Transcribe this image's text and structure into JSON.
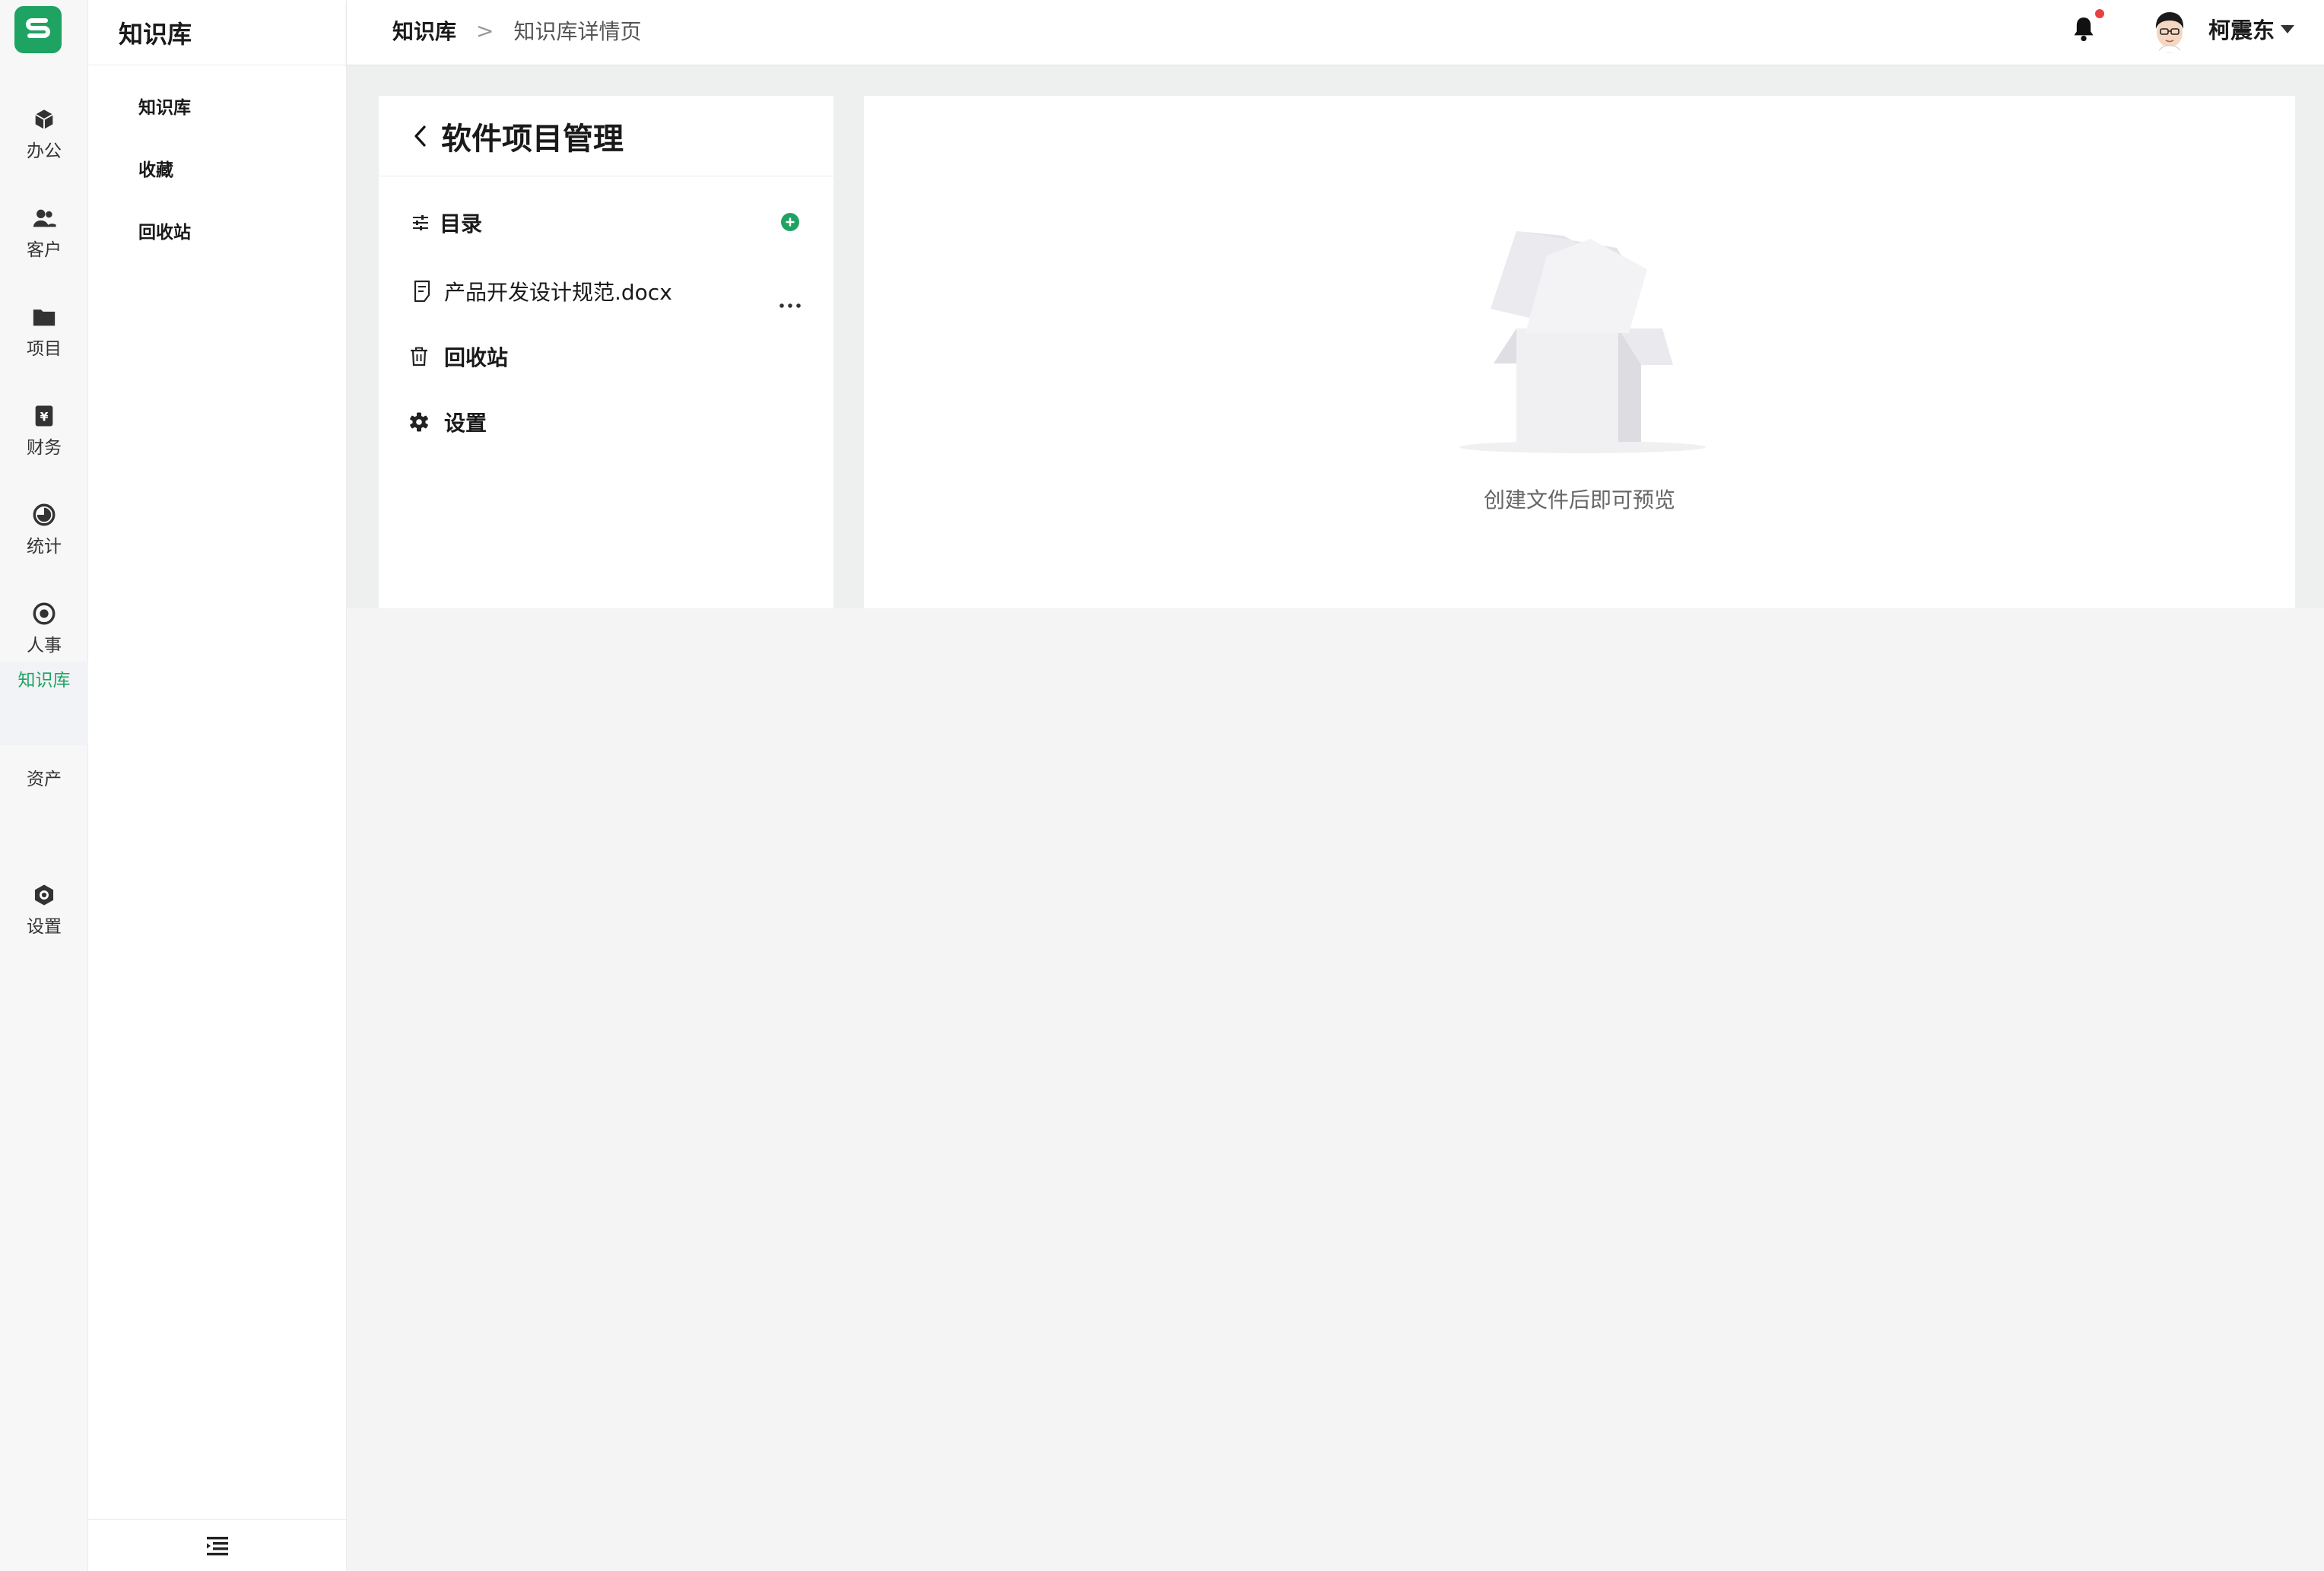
{
  "rail": {
    "logo": "S",
    "items": [
      {
        "label": "办公",
        "icon": "cube-icon"
      },
      {
        "label": "客户",
        "icon": "users-icon"
      },
      {
        "label": "项目",
        "icon": "folder-icon"
      },
      {
        "label": "财务",
        "icon": "yen-icon"
      },
      {
        "label": "统计",
        "icon": "pie-chart-icon"
      },
      {
        "label": "人事",
        "icon": "target-icon"
      },
      {
        "label": "知识库",
        "icon": "book-icon"
      },
      {
        "label": "资产",
        "icon": "asset-icon"
      },
      {
        "label": "设置",
        "icon": "hexagon-gear-icon"
      }
    ]
  },
  "subnav": {
    "title": "知识库",
    "items": [
      {
        "label": "知识库"
      },
      {
        "label": "收藏"
      },
      {
        "label": "回收站"
      }
    ]
  },
  "header": {
    "breadcrumb": [
      "知识库",
      ">",
      "知识库详情页"
    ],
    "user_name": "柯震东"
  },
  "left_panel": {
    "title": "软件项目管理",
    "catalog_label": "目录",
    "document_name": "产品开发设计规范.docx",
    "recycle_label": "回收站",
    "settings_label": "设置"
  },
  "preview": {
    "empty_text": "创建文件后即可预览"
  },
  "colors": {
    "accent": "#1fa363",
    "notification": "#e54343"
  }
}
